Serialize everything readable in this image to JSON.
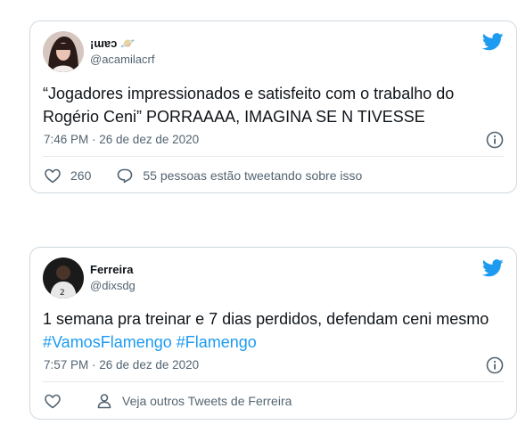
{
  "tweets": [
    {
      "display_name": "¡ɯɐɔ 🪐",
      "handle": "@acamilacrf",
      "text": "“Jogadores impressionados e satisfeito com o trabalho do Rogério Ceni” PORRAAAA, IMAGINA SE N TIVESSE",
      "timestamp": "7:46 PM · 26 de dez de 2020",
      "likes": "260",
      "reply_text": "55 pessoas estão tweetando sobre isso"
    },
    {
      "display_name": "Ferreira",
      "handle": "@dixsdg",
      "text_plain": "1 semana pra treinar e 7 dias perdidos, defendam ceni mesmo",
      "hashtags": [
        "#VamosFlamengo",
        "#Flamengo"
      ],
      "timestamp": "7:57 PM · 26 de dez de 2020",
      "profile_link": "Veja outros Tweets de Ferreira"
    }
  ],
  "colors": {
    "accent": "#1d9bf0",
    "muted": "#536471",
    "border": "#cfd9de"
  },
  "icons": [
    "twitter-bird-icon",
    "info-icon",
    "heart-icon",
    "reply-icon",
    "person-icon"
  ]
}
